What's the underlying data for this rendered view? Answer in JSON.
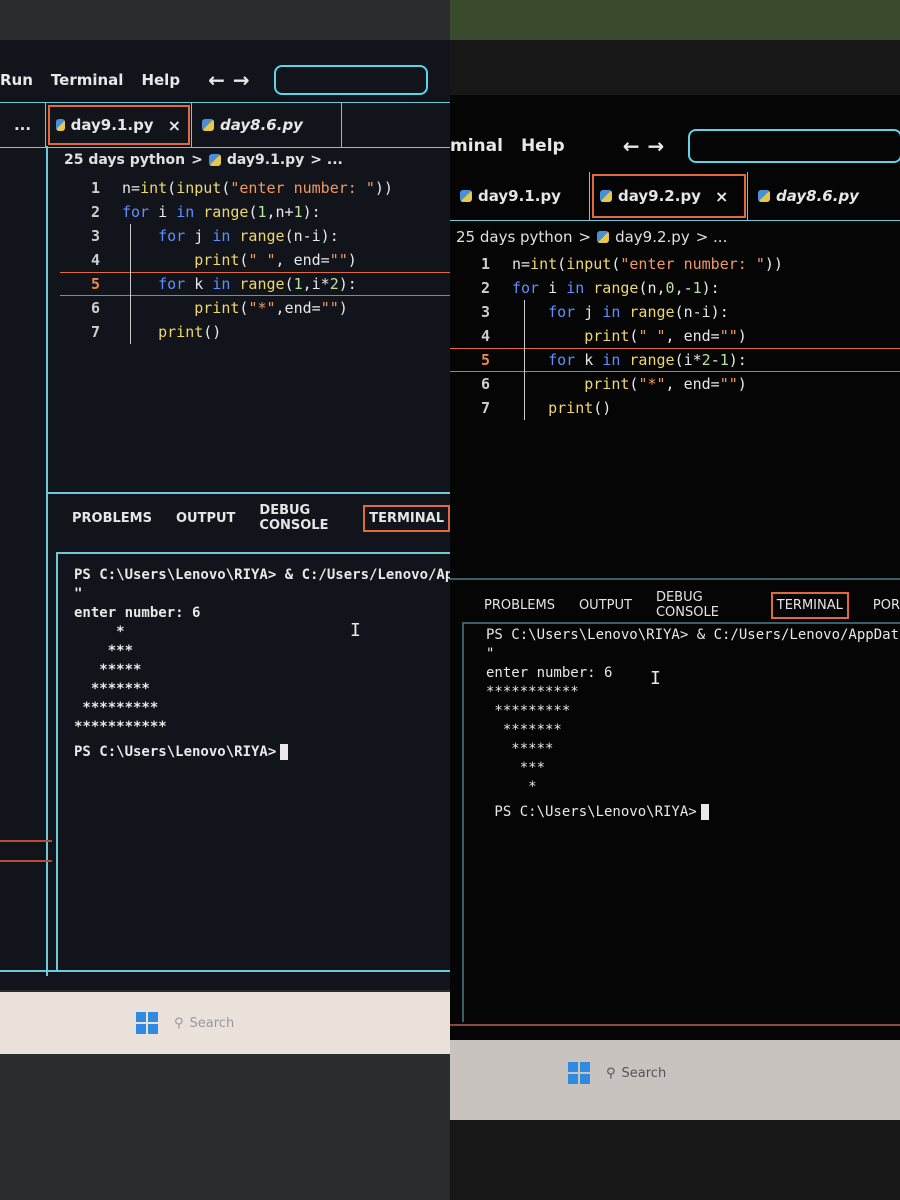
{
  "panels": [
    {
      "menu": [
        "Run",
        "Terminal",
        "Help"
      ],
      "ellipsis": "...",
      "tabs": [
        {
          "label": "day9.1.py",
          "active": true,
          "close": "×"
        },
        {
          "label": "day8.6.py",
          "active": false,
          "italic": true
        }
      ],
      "breadcrumb": {
        "folder": "25 days python",
        "sep": ">",
        "file": "day9.1.py",
        "tail": "> ..."
      },
      "highlight_line": 5,
      "code": [
        {
          "n": "1",
          "t": [
            [
              "tx",
              "n="
            ],
            [
              "fn",
              "int"
            ],
            [
              "tx",
              "("
            ],
            [
              "fn",
              "input"
            ],
            [
              "tx",
              "("
            ],
            [
              "st",
              "\"enter number: \""
            ],
            [
              "tx",
              "))"
            ]
          ]
        },
        {
          "n": "2",
          "t": [
            [
              "kw",
              "for"
            ],
            [
              "tx",
              " i "
            ],
            [
              "kw",
              "in"
            ],
            [
              "tx",
              " "
            ],
            [
              "fn",
              "range"
            ],
            [
              "tx",
              "("
            ],
            [
              "nm",
              "1"
            ],
            [
              "tx",
              ",n+"
            ],
            [
              "nm",
              "1"
            ],
            [
              "tx",
              "):"
            ]
          ]
        },
        {
          "n": "3",
          "t": [
            [
              "tx",
              "    "
            ],
            [
              "kw",
              "for"
            ],
            [
              "tx",
              " j "
            ],
            [
              "kw",
              "in"
            ],
            [
              "tx",
              " "
            ],
            [
              "fn",
              "range"
            ],
            [
              "tx",
              "(n-i):"
            ]
          ]
        },
        {
          "n": "4",
          "t": [
            [
              "tx",
              "        "
            ],
            [
              "fn",
              "print"
            ],
            [
              "tx",
              "("
            ],
            [
              "st",
              "\" \""
            ],
            [
              "tx",
              ", end="
            ],
            [
              "st",
              "\"\""
            ],
            [
              "tx",
              ")"
            ]
          ]
        },
        {
          "n": "5",
          "t": [
            [
              "tx",
              "    "
            ],
            [
              "kw",
              "for"
            ],
            [
              "tx",
              " k "
            ],
            [
              "kw",
              "in"
            ],
            [
              "tx",
              " "
            ],
            [
              "fn",
              "range"
            ],
            [
              "tx",
              "("
            ],
            [
              "nm",
              "1"
            ],
            [
              "tx",
              ",i*"
            ],
            [
              "nm",
              "2"
            ],
            [
              "tx",
              "):"
            ]
          ]
        },
        {
          "n": "6",
          "t": [
            [
              "tx",
              "        "
            ],
            [
              "fn",
              "print"
            ],
            [
              "tx",
              "("
            ],
            [
              "st",
              "\"*\""
            ],
            [
              "tx",
              ",end="
            ],
            [
              "st",
              "\"\""
            ],
            [
              "tx",
              ")"
            ]
          ]
        },
        {
          "n": "7",
          "t": [
            [
              "tx",
              "    "
            ],
            [
              "fn",
              "print"
            ],
            [
              "tx",
              "()"
            ]
          ]
        }
      ],
      "panel_tabs": [
        "PROBLEMS",
        "OUTPUT",
        "DEBUG CONSOLE",
        "TERMINAL"
      ],
      "terminal": [
        "PS C:\\Users\\Lenovo\\RIYA> & C:/Users/Lenovo/Ap",
        "\"",
        "enter number: 6",
        "     *",
        "    ***",
        "   *****",
        "  *******",
        " *********",
        "***********",
        "PS C:\\Users\\Lenovo\\RIYA>"
      ],
      "taskbar_search": "Search"
    },
    {
      "menu": [
        "minal",
        "Help"
      ],
      "tabs": [
        {
          "label": "day9.1.py",
          "active": false
        },
        {
          "label": "day9.2.py",
          "active": true,
          "close": "×"
        },
        {
          "label": "day8.6.py",
          "active": false,
          "italic": true
        }
      ],
      "breadcrumb": {
        "folder": "25 days python",
        "sep": ">",
        "file": "day9.2.py",
        "tail": "> ..."
      },
      "highlight_line": 5,
      "code": [
        {
          "n": "1",
          "t": [
            [
              "tx",
              "n="
            ],
            [
              "fn",
              "int"
            ],
            [
              "tx",
              "("
            ],
            [
              "fn",
              "input"
            ],
            [
              "tx",
              "("
            ],
            [
              "st",
              "\"enter number: \""
            ],
            [
              "tx",
              "))"
            ]
          ]
        },
        {
          "n": "2",
          "t": [
            [
              "kw",
              "for"
            ],
            [
              "tx",
              " i "
            ],
            [
              "kw",
              "in"
            ],
            [
              "tx",
              " "
            ],
            [
              "fn",
              "range"
            ],
            [
              "tx",
              "(n,"
            ],
            [
              "nm",
              "0"
            ],
            [
              "tx",
              ",-"
            ],
            [
              "nm",
              "1"
            ],
            [
              "tx",
              "):"
            ]
          ]
        },
        {
          "n": "3",
          "t": [
            [
              "tx",
              "    "
            ],
            [
              "kw",
              "for"
            ],
            [
              "tx",
              " j "
            ],
            [
              "kw",
              "in"
            ],
            [
              "tx",
              " "
            ],
            [
              "fn",
              "range"
            ],
            [
              "tx",
              "(n-i):"
            ]
          ]
        },
        {
          "n": "4",
          "t": [
            [
              "tx",
              "        "
            ],
            [
              "fn",
              "print"
            ],
            [
              "tx",
              "("
            ],
            [
              "st",
              "\" \""
            ],
            [
              "tx",
              ", end="
            ],
            [
              "st",
              "\"\""
            ],
            [
              "tx",
              ")"
            ]
          ]
        },
        {
          "n": "5",
          "t": [
            [
              "tx",
              "    "
            ],
            [
              "kw",
              "for"
            ],
            [
              "tx",
              " k "
            ],
            [
              "kw",
              "in"
            ],
            [
              "tx",
              " "
            ],
            [
              "fn",
              "range"
            ],
            [
              "tx",
              "(i*"
            ],
            [
              "nm",
              "2"
            ],
            [
              "tx",
              "-"
            ],
            [
              "nm",
              "1"
            ],
            [
              "tx",
              "):"
            ]
          ]
        },
        {
          "n": "6",
          "t": [
            [
              "tx",
              "        "
            ],
            [
              "fn",
              "print"
            ],
            [
              "tx",
              "("
            ],
            [
              "st",
              "\"*\""
            ],
            [
              "tx",
              ", end="
            ],
            [
              "st",
              "\"\""
            ],
            [
              "tx",
              ")"
            ]
          ]
        },
        {
          "n": "7",
          "t": [
            [
              "tx",
              "    "
            ],
            [
              "fn",
              "print"
            ],
            [
              "tx",
              "()"
            ]
          ]
        }
      ],
      "panel_tabs": [
        "PROBLEMS",
        "OUTPUT",
        "DEBUG CONSOLE",
        "TERMINAL",
        "POR"
      ],
      "terminal": [
        "PS C:\\Users\\Lenovo\\RIYA> & C:/Users/Lenovo/AppDat",
        "\"",
        "enter number: 6",
        "***********",
        " *********",
        "  *******",
        "   *****",
        "    ***",
        "     *",
        " PS C:\\Users\\Lenovo\\RIYA>"
      ],
      "taskbar_search": "Search"
    }
  ],
  "colors": {
    "accent_border": "#6fc9d6",
    "active_tab": "#e06a3a",
    "keyword": "#5f8fff",
    "function": "#f0d86a",
    "string": "#f09a63",
    "number": "#b8e3a0"
  },
  "icons": [
    "arrow-left-icon",
    "arrow-right-icon",
    "python-file-icon",
    "close-icon",
    "windows-start-icon",
    "search-icon",
    "text-cursor-icon"
  ]
}
